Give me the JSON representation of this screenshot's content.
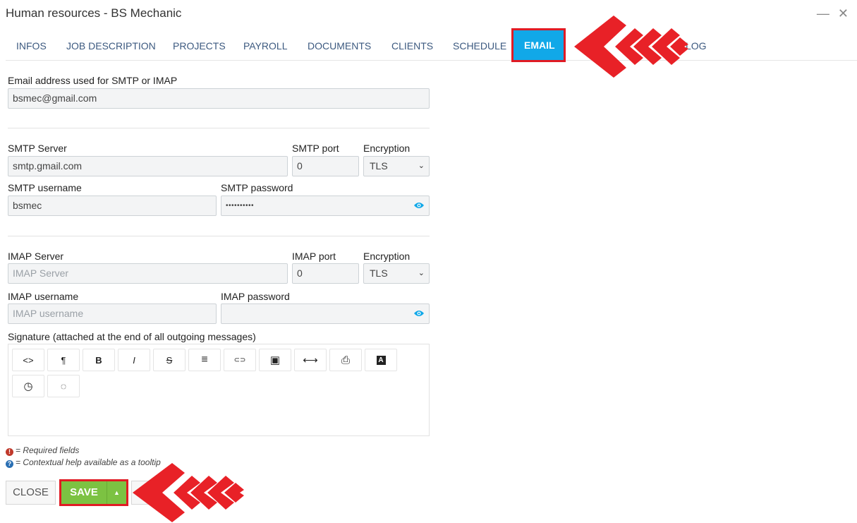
{
  "window": {
    "title": "Human resources - BS Mechanic",
    "minimize_icon": "minimize-icon",
    "close_icon": "close-icon"
  },
  "tabs": [
    {
      "label": "INFOS"
    },
    {
      "label": "JOB DESCRIPTION"
    },
    {
      "label": "PROJECTS"
    },
    {
      "label": "PAYROLL"
    },
    {
      "label": "DOCUMENTS"
    },
    {
      "label": "CLIENTS"
    },
    {
      "label": "SCHEDULE"
    },
    {
      "label": "EMAIL",
      "active": true
    },
    {
      "label": "LOG"
    }
  ],
  "email": {
    "label": "Email address used for SMTP or IMAP",
    "value": "bsmec@gmail.com"
  },
  "smtp": {
    "server_label": "SMTP Server",
    "server_value": "smtp.gmail.com",
    "port_label": "SMTP port",
    "port_value": "0",
    "encryption_label": "Encryption",
    "encryption_value": "TLS",
    "username_label": "SMTP username",
    "username_value": "bsmec",
    "password_label": "SMTP password",
    "password_value": "••••••••••"
  },
  "imap": {
    "server_label": "IMAP Server",
    "server_placeholder": "IMAP Server",
    "port_label": "IMAP port",
    "port_value": "0",
    "encryption_label": "Encryption",
    "encryption_value": "TLS",
    "username_label": "IMAP username",
    "username_placeholder": "IMAP username",
    "password_label": "IMAP password",
    "password_value": ""
  },
  "signature": {
    "label": "Signature (attached at the end of all outgoing messages)",
    "toolbar_icons": [
      "code-view-icon",
      "paragraph-icon",
      "bold-icon",
      "italic-icon",
      "strikethrough-icon",
      "list-icon",
      "link-icon",
      "image-icon",
      "horizontal-rule-icon",
      "print-icon",
      "font-icon",
      "clock-icon",
      "comment-icon"
    ],
    "toolbar_glyphs": [
      "<>",
      "¶",
      "B",
      "I",
      "S",
      "≡",
      "⊂⊃",
      "▣",
      "⟷",
      "⎙",
      "A",
      "◷",
      "◌"
    ]
  },
  "notes": {
    "required": "= Required fields",
    "help": "= Contextual help available as a tooltip"
  },
  "buttons": {
    "close": "CLOSE",
    "save": "SAVE",
    "save_dropdown": "▲"
  },
  "colors": {
    "accent": "#11a8e8",
    "save": "#7cc242",
    "highlight": "#e01b24",
    "tab_text": "#3d5a80"
  }
}
